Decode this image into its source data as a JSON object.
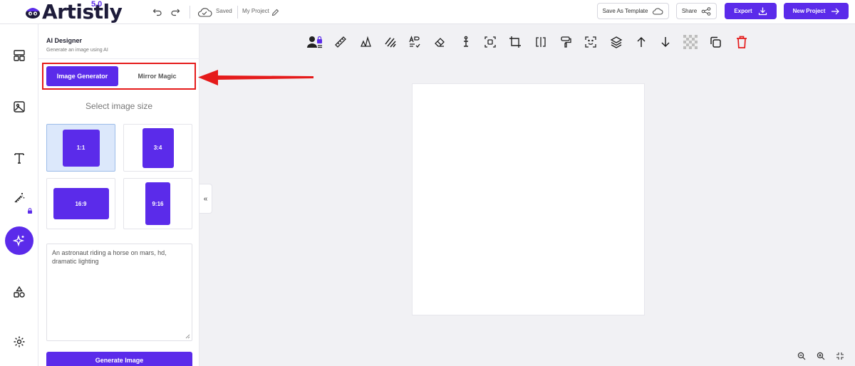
{
  "brand": {
    "name": "Artistly",
    "version": "5.0",
    "accent": "#5b2bea",
    "annotation_color": "#e51b1b"
  },
  "header": {
    "saved_label": "Saved",
    "project_name": "My Project",
    "save_template_label": "Save As Template",
    "share_label": "Share",
    "export_label": "Export",
    "new_project_label": "New Project"
  },
  "rail": {
    "items": [
      {
        "icon": "layout-icon"
      },
      {
        "icon": "image-icon"
      },
      {
        "icon": "text-icon"
      },
      {
        "icon": "magic-wand-icon",
        "locked": true
      },
      {
        "icon": "ai-sparkle-icon",
        "active": true
      },
      {
        "icon": "shapes-icon"
      },
      {
        "icon": "settings-icon"
      }
    ]
  },
  "panel": {
    "title": "AI Designer",
    "subtitle": "Generate an image using AI",
    "tabs": [
      {
        "label": "Image Generator",
        "active": true
      },
      {
        "label": "Mirror Magic",
        "active": false
      }
    ],
    "size_label": "Select image size",
    "sizes": [
      {
        "label": "1:1",
        "selected": true
      },
      {
        "label": "3:4",
        "selected": false
      },
      {
        "label": "16:9",
        "selected": false
      },
      {
        "label": "9:16",
        "selected": false
      }
    ],
    "prompt_value": "An astronaut riding a horse on mars, hd, dramatic lighting",
    "generate_label": "Generate Image",
    "collapse_glyph": "«"
  },
  "toolbar": {
    "tools": [
      "user-lock-icon",
      "ruler-icon",
      "flip-icon",
      "stripes-icon",
      "text-check-icon",
      "eraser-icon",
      "position-icon",
      "bounds-icon",
      "crop-icon",
      "mirror-icon",
      "paint-roller-icon",
      "focus-icon",
      "layers-icon",
      "arrow-up-icon",
      "arrow-down-icon",
      "transparency-icon",
      "duplicate-icon",
      "trash-icon"
    ]
  }
}
